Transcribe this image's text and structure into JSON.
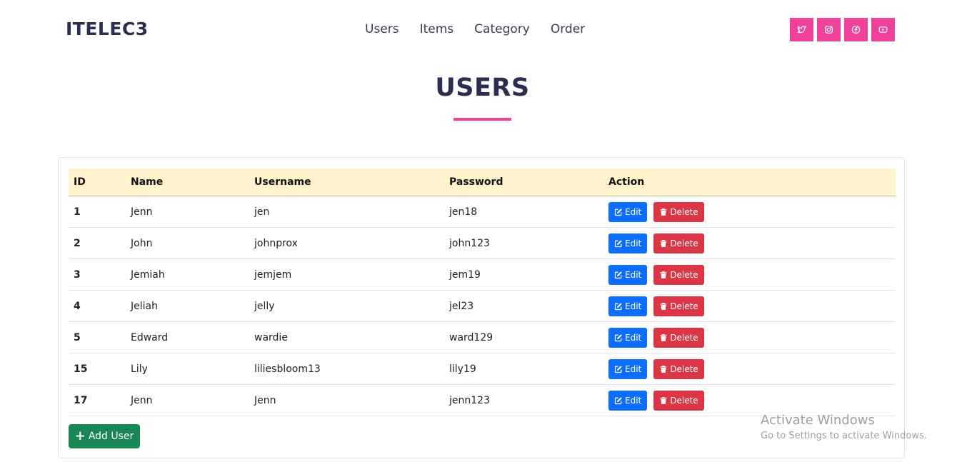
{
  "brand": "ITELEC3",
  "nav": [
    "Users",
    "Items",
    "Category",
    "Order"
  ],
  "social_icons": [
    "twitter-icon",
    "instagram-icon",
    "facebook-icon",
    "youtube-icon"
  ],
  "accent_color": "#f0419a",
  "page_title": "USERS",
  "table": {
    "headers": [
      "ID",
      "Name",
      "Username",
      "Password",
      "Action"
    ],
    "rows": [
      {
        "id": "1",
        "name": "Jenn",
        "username": "jen",
        "password": "jen18"
      },
      {
        "id": "2",
        "name": "John",
        "username": "johnprox",
        "password": "john123"
      },
      {
        "id": "3",
        "name": "Jemiah",
        "username": "jemjem",
        "password": "jem19"
      },
      {
        "id": "4",
        "name": "Jeliah",
        "username": "jelly",
        "password": "jel23"
      },
      {
        "id": "5",
        "name": "Edward",
        "username": "wardie",
        "password": "ward129"
      },
      {
        "id": "15",
        "name": "Lily",
        "username": "liliesbloom13",
        "password": "lily19"
      },
      {
        "id": "17",
        "name": "Jenn",
        "username": "Jenn",
        "password": "jenn123"
      }
    ]
  },
  "edit_label": "Edit",
  "delete_label": "Delete",
  "add_user_label": "Add User",
  "watermark": {
    "line1": "Activate Windows",
    "line2": "Go to Settings to activate Windows."
  }
}
